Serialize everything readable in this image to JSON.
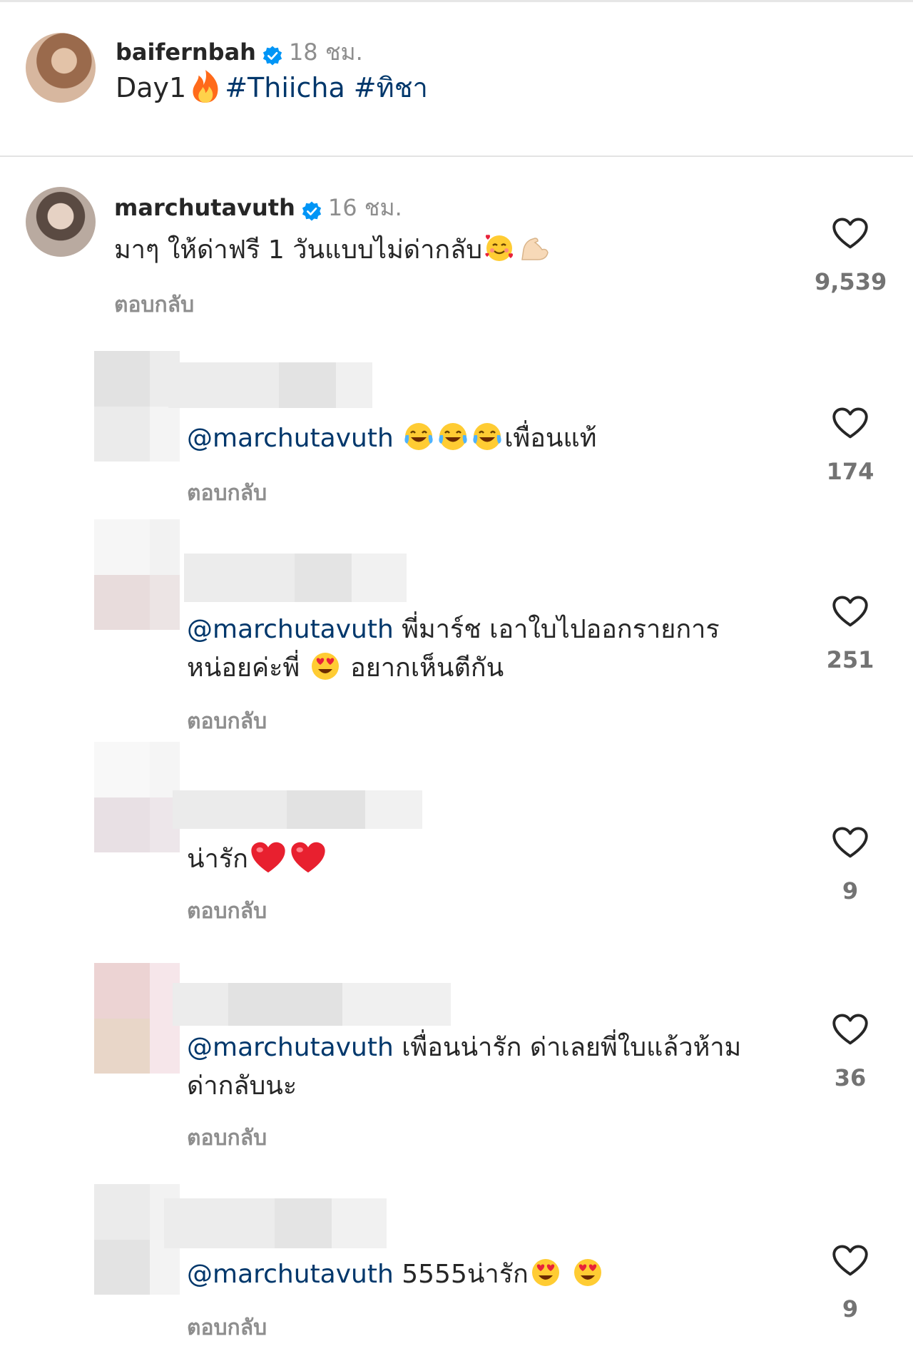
{
  "post": {
    "username": "baifernbah",
    "time": "18 ชม.",
    "text": "Day1",
    "hashtags": "#Thiicha #ทิชา"
  },
  "comments": [
    {
      "username": "marchutavuth",
      "time": "16 ชม.",
      "text": "มาๆ ให้ด่าฟรี 1 วันแบบไม่ด่ากลับ",
      "reply": "ตอบกลับ",
      "likes": "9,539"
    },
    {
      "mention": "@marchutavuth",
      "text": "เพื่อนแท้",
      "reply": "ตอบกลับ",
      "likes": "174"
    },
    {
      "mention": "@marchutavuth",
      "text_line1": "พี่มาร์ช เอาใบไปออกรายการ",
      "text_line2a": "หน่อยค่ะพี่",
      "text_line2b": "อยากเห็นตีกัน",
      "reply": "ตอบกลับ",
      "likes": "251"
    },
    {
      "text": "น่ารัก",
      "reply": "ตอบกลับ",
      "likes": "9"
    },
    {
      "mention": "@marchutavuth",
      "text_line1": "เพื่อนน่ารัก ด่าเลยพี่ใบแล้วห้าม",
      "text_line2": "ด่ากลับนะ",
      "reply": "ตอบกลับ",
      "likes": "36"
    },
    {
      "mention": "@marchutavuth",
      "text": "5555น่ารัก",
      "reply": "ตอบกลับ",
      "likes": "9"
    }
  ],
  "icons": {
    "verified": "verified-badge-icon",
    "heart": "heart-outline-icon",
    "fire": "fire-emoji",
    "laugh": "tears-of-joy-emoji",
    "heart_eyes": "heart-eyes-emoji",
    "red_heart": "red-heart-emoji",
    "smiling_hearts": "smiling-face-with-hearts-emoji",
    "muscle": "flexed-biceps-emoji"
  },
  "colors": {
    "link": "#00376b",
    "verified": "#0095f6",
    "muted": "#8e8e8e"
  }
}
